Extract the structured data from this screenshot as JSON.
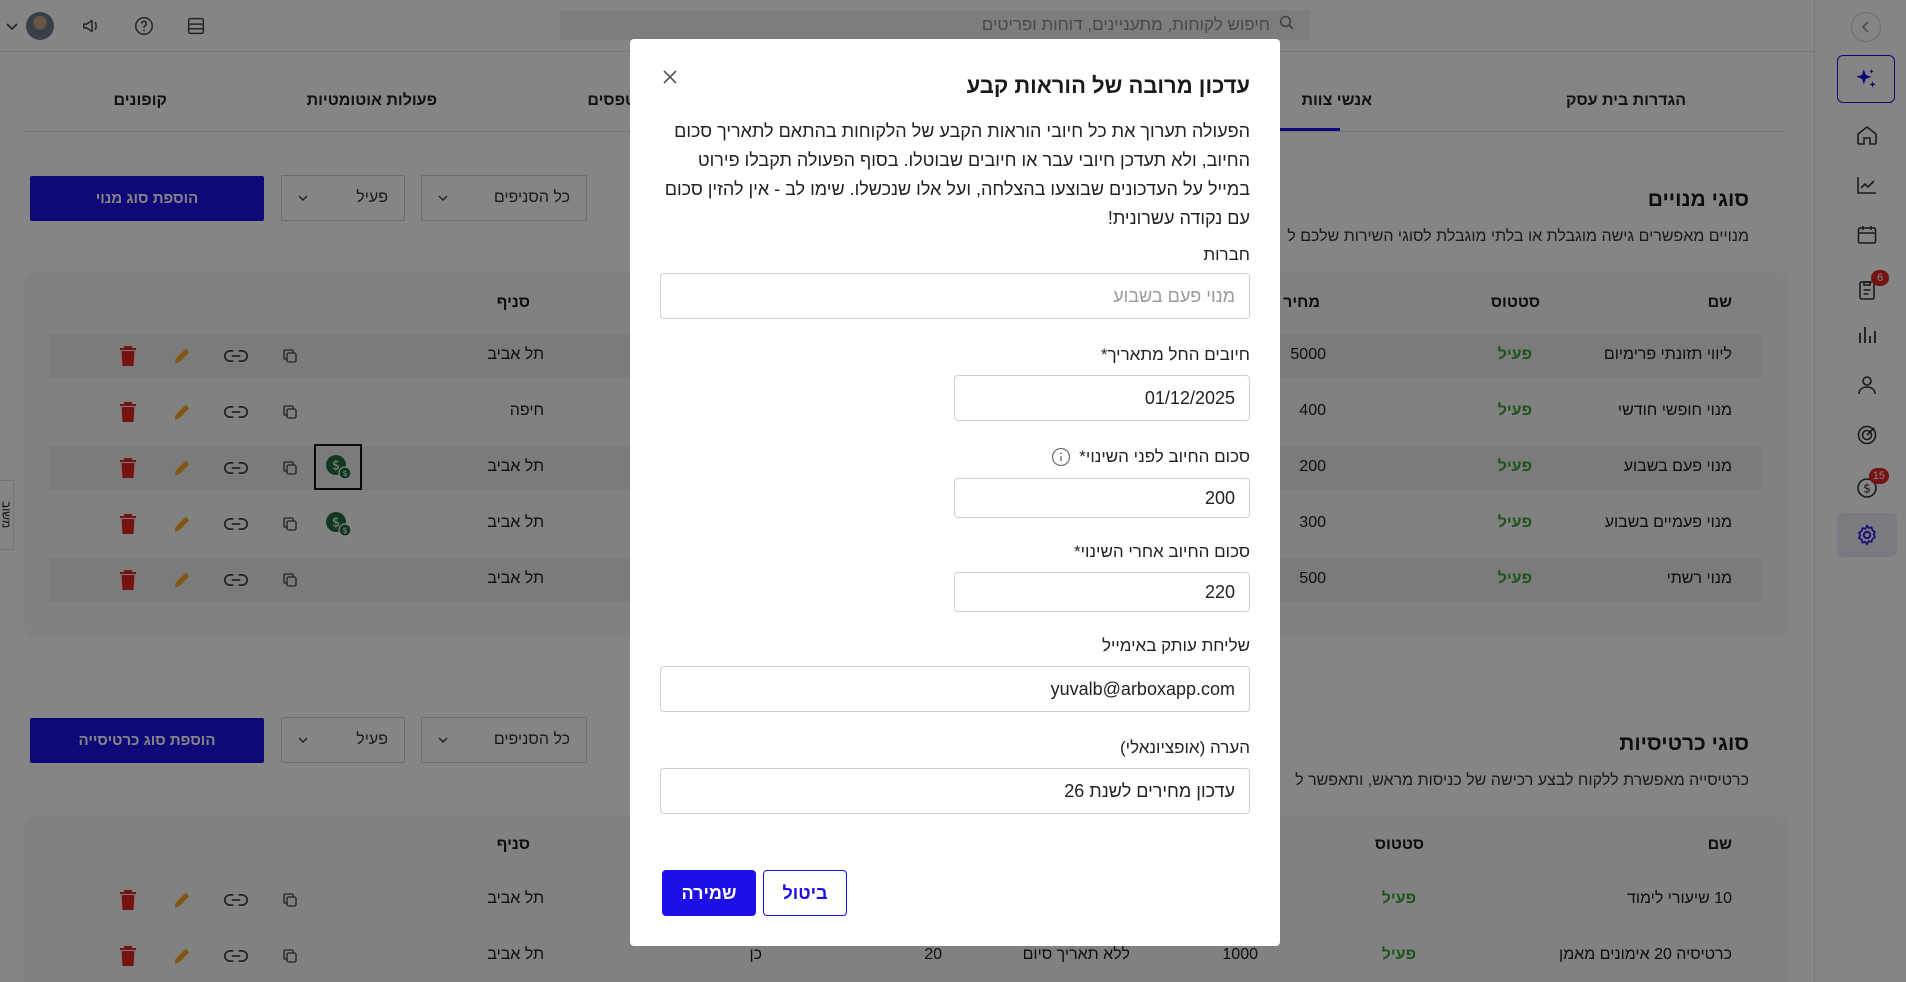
{
  "topbar": {
    "search_placeholder": "חיפוש לקוחות, מתעניינים, דוחות ופריטים"
  },
  "sidebar": {
    "items": [
      {
        "icon": "sparkle-icon"
      },
      {
        "icon": "home-icon"
      },
      {
        "icon": "trend-chart-icon"
      },
      {
        "icon": "calendar-icon"
      },
      {
        "icon": "clipboard-icon",
        "badge": "6"
      },
      {
        "icon": "bar-chart-icon"
      },
      {
        "icon": "user-icon"
      },
      {
        "icon": "target-icon"
      },
      {
        "icon": "dollar-icon",
        "badge": "15"
      },
      {
        "icon": "gear-icon"
      }
    ]
  },
  "tabs": [
    "הגדרות בית עסק",
    "אנשי צוות",
    "טפסים",
    "פעולות אוטומטיות",
    "קופונים"
  ],
  "memberships": {
    "title": "סוגי מנויים",
    "description": "מנויים מאפשרים גישה מוגבלת או בלתי מוגבלת לסוגי השירות שלכם ל",
    "add_button": "הוספת סוג מנוי",
    "branch_filter": "כל הסניפים",
    "status_filter": "פעיל",
    "headers": {
      "name": "שם",
      "status": "סטטוס",
      "price": "מחיר",
      "branch": "סניף"
    },
    "rows": [
      {
        "name": "ליווי תזונתי פרימיום",
        "status": "פעיל",
        "price": "5000",
        "branch": "תל אביב"
      },
      {
        "name": "מנוי חופשי חודשי",
        "status": "פעיל",
        "price": "400",
        "branch": "חיפה"
      },
      {
        "name": "מנוי פעם בשבוע",
        "status": "פעיל",
        "price": "200",
        "branch": "תל אביב"
      },
      {
        "name": "מנוי פעמיים בשבוע",
        "status": "פעיל",
        "price": "300",
        "branch": "תל אביב"
      },
      {
        "name": "מנוי רשתי",
        "status": "פעיל",
        "price": "500",
        "branch": "תל אביב"
      }
    ]
  },
  "punchcards": {
    "title": "סוגי כרטיסיות",
    "description": "כרטיסייה מאפשרת ללקוח לבצע רכישה של כניסות מראש, ותאפשר ל",
    "add_button": "הוספת סוג כרטיסייה",
    "branch_filter": "כל הסניפים",
    "status_filter": "פעיל",
    "headers": {
      "name": "שם",
      "status": "סטטוס",
      "branch": "סניף"
    },
    "rows": [
      {
        "name": "10 שיעורי לימוד",
        "status": "פעיל",
        "price": "",
        "expiry": "",
        "entries": "",
        "flag": "",
        "branch": "תל אביב"
      },
      {
        "name": "כרטיסיה 20 אימונים מאמן",
        "status": "פעיל",
        "price": "1000",
        "expiry": "ללא תאריך סיום",
        "entries": "20",
        "flag": "כן",
        "branch": "תל אביב"
      }
    ]
  },
  "side_tab_label": "משוב",
  "modal": {
    "title": "עדכון מרובה של הוראות קבע",
    "description": "הפעולה תערוך את כל חיובי הוראות הקבע של הלקוחות בהתאם לתאריך סכום החיוב, ולא תעדכן חיובי עבר או חיובים שבוטלו. בסוף הפעולה תקבלו פירוט במייל על העדכונים שבוצעו בהצלחה, ועל אלו שנכשלו. שימו לב - אין להזין סכום עם נקודה עשרונית!",
    "memberships_label": "חברות",
    "memberships_placeholder": "מנוי פעם בשבוע",
    "from_date_label": "חיובים החל מתאריך*",
    "from_date_value": "01/12/2025",
    "amount_before_label": "סכום החיוב לפני השינוי*",
    "amount_before_value": "200",
    "amount_after_label": "סכום החיוב אחרי השינוי*",
    "amount_after_value": "220",
    "email_label": "שליחת עותק באימייל",
    "email_value": "yuvalb@arboxapp.com",
    "note_label": "הערה (אופציונאלי)",
    "note_value": "עדכון מחירים לשנת 26",
    "save_button": "שמירה",
    "cancel_button": "ביטול"
  },
  "colors": {
    "accent": "#1d10e6",
    "active_status": "#3aa339",
    "delete": "#e02424",
    "edit": "#f5a623",
    "money": "#1f6b3a"
  }
}
